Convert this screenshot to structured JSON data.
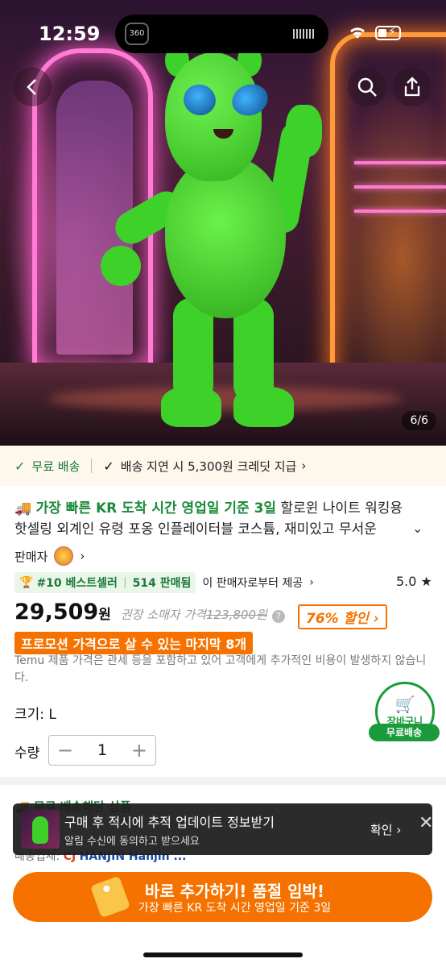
{
  "status_bar": {
    "time": "12:59",
    "camera_badge": "360"
  },
  "gallery": {
    "counter": "6/6"
  },
  "shipping_strip": {
    "free_shipping": "무료 배송",
    "delay_credit": "배송 지연 시 5,300원 크레딧 지급"
  },
  "product": {
    "fast_arrival": "가장 빠른 KR 도착 시간 영업일 기준 3일",
    "title": "할로윈 나이트 워킹용 핫셀링 외계인 유령 포옹 인플레이터블 코스튬, 재미있고 무서운"
  },
  "seller": {
    "label": "판매자"
  },
  "bestseller": {
    "rank": "#10 베스트셀러",
    "sold": "514 판매됨",
    "provided_by": "이 판매자로부터 제공",
    "rating": "5.0"
  },
  "price": {
    "current": "29,509",
    "unit": "원",
    "rrp_label": "권장 소매자 가격",
    "rrp": "123,800원",
    "discount": "76% 할인",
    "promo": "프로모션 가격으로 살 수 있는 마지막 8개",
    "tax_note": "Temu 제품 가격은 관세 등을 포함하고 있어 고객에게 추가적인 비용이 발생하지 않습니다."
  },
  "options": {
    "size_label": "크기: L",
    "qty_label": "수량",
    "qty_value": "1"
  },
  "cart_fab": {
    "label": "장바구니",
    "badge": "무료배송"
  },
  "shipping_section": {
    "title": "무료 배송해당 상품",
    "carrier_prefix": "배송업체:",
    "carrier_cj": "CJ",
    "carrier_hanjin": "HANJIN Hanjin ..."
  },
  "toast": {
    "title": "구매 후 적시에 추적 업데이트 정보받기",
    "subtitle": "알림 수신에 동의하고 받으세요",
    "confirm": "확인"
  },
  "cta": {
    "main": "바로 추가하기! 품절 임박!",
    "sub": "가장 빠른 KR 도착 시간 영업일 기준 3일"
  },
  "colors": {
    "accent": "#f57200",
    "green": "#1a8a3a"
  }
}
